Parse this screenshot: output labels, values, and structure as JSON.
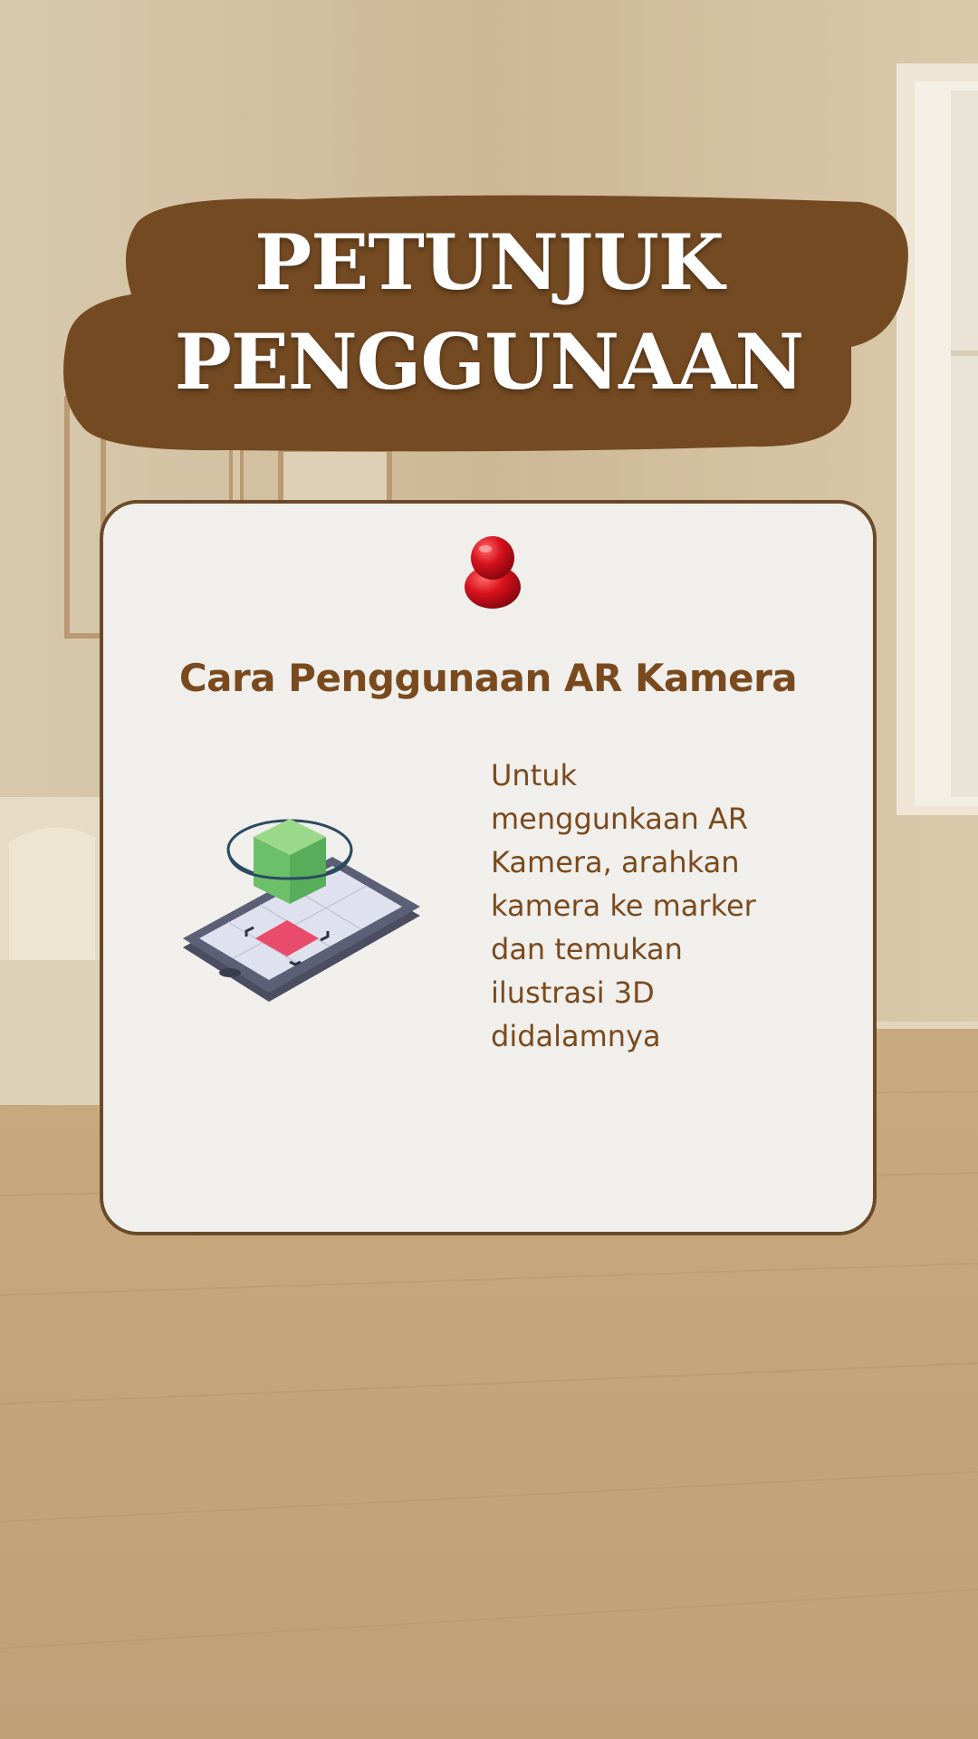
{
  "header": {
    "title_line1": "PETUNJUK",
    "title_line2": "PENGGUNAAN"
  },
  "card": {
    "title": "Cara Penggunaan AR Kamera",
    "body": "Untuk\nmenggunkaan AR\nKamera, arahkan\nkamera ke marker\ndan temukan\nilustrasi 3D\ndidalamnya"
  },
  "colors": {
    "banner_brown": "#744a22",
    "card_background": "#f0efeb",
    "card_border": "#6b4a2a",
    "text_brown": "#7a4a1e",
    "pin_red": "#d8121e"
  }
}
